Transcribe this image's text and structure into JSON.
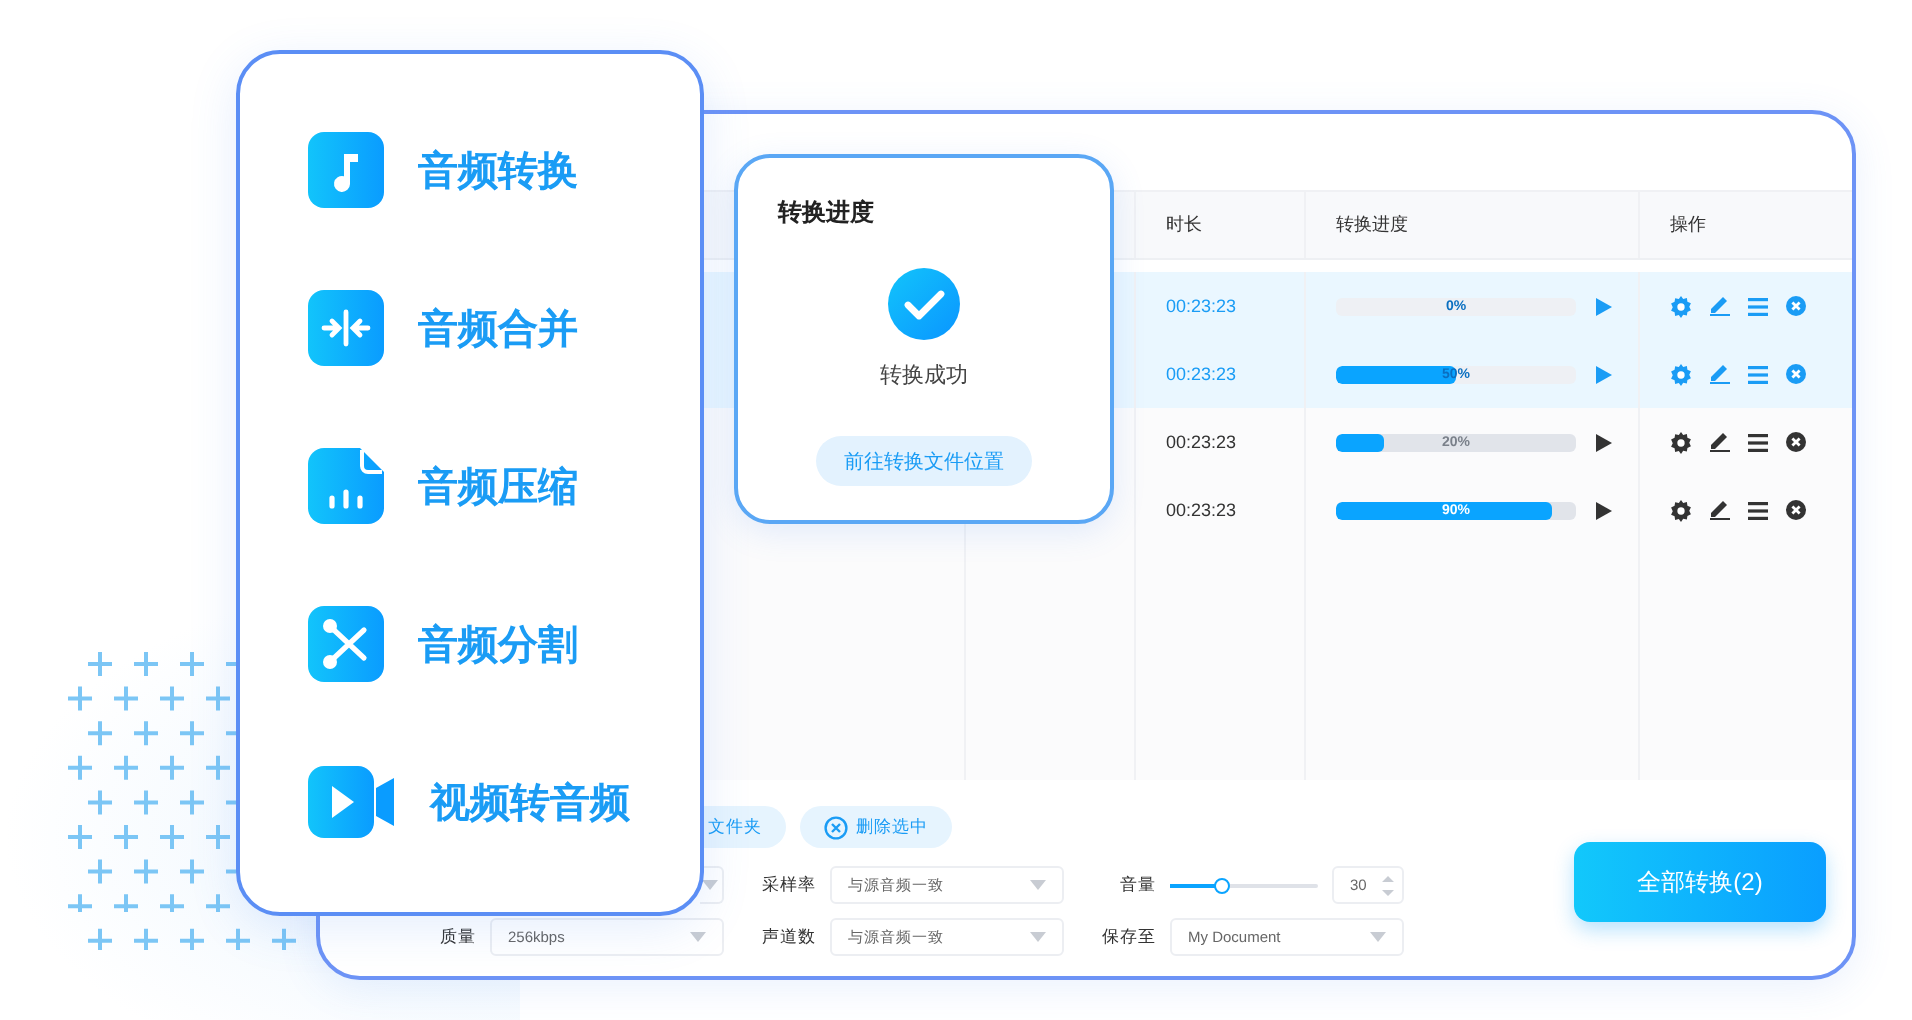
{
  "sidebar": {
    "items": [
      {
        "kind": "music",
        "label": "音频转换"
      },
      {
        "kind": "merge",
        "label": "音频合并"
      },
      {
        "kind": "compress",
        "label": "音频压缩"
      },
      {
        "kind": "split",
        "label": "音频分割"
      },
      {
        "kind": "video",
        "label": "视频转音频"
      }
    ]
  },
  "table": {
    "columns": [
      "时长",
      "转换进度",
      "操作"
    ],
    "rows": [
      {
        "selected": true,
        "duration": "00:23:23",
        "progress": "0%"
      },
      {
        "selected": true,
        "duration": "00:23:23",
        "level": 0.5,
        "progress": "50%"
      },
      {
        "selected": false,
        "duration": "00:23:23",
        "level": 0.2,
        "progress": "20%"
      },
      {
        "selected": false,
        "duration": "00:23:23",
        "level": 0.9,
        "progress": "90%"
      }
    ]
  },
  "popup": {
    "title": "转换进度",
    "status": "转换成功",
    "button": "前往转换文件位置"
  },
  "toolbar": {
    "buttons": [
      {
        "kind": "folder",
        "label": "文件夹"
      },
      {
        "kind": "delete",
        "label": "删除选中"
      }
    ]
  },
  "settings": {
    "sample_rate": {
      "label": "采样率",
      "value": "与源音频一致"
    },
    "volume": {
      "label": "音量",
      "level": 0.35,
      "value": "30"
    },
    "quality": {
      "label": "质量",
      "value": "256kbps"
    },
    "channels": {
      "label": "声道数",
      "value": "与源音频一致"
    },
    "save_to": {
      "label": "保存至",
      "value": "My Document"
    }
  },
  "convert_all": "全部转换(2)"
}
